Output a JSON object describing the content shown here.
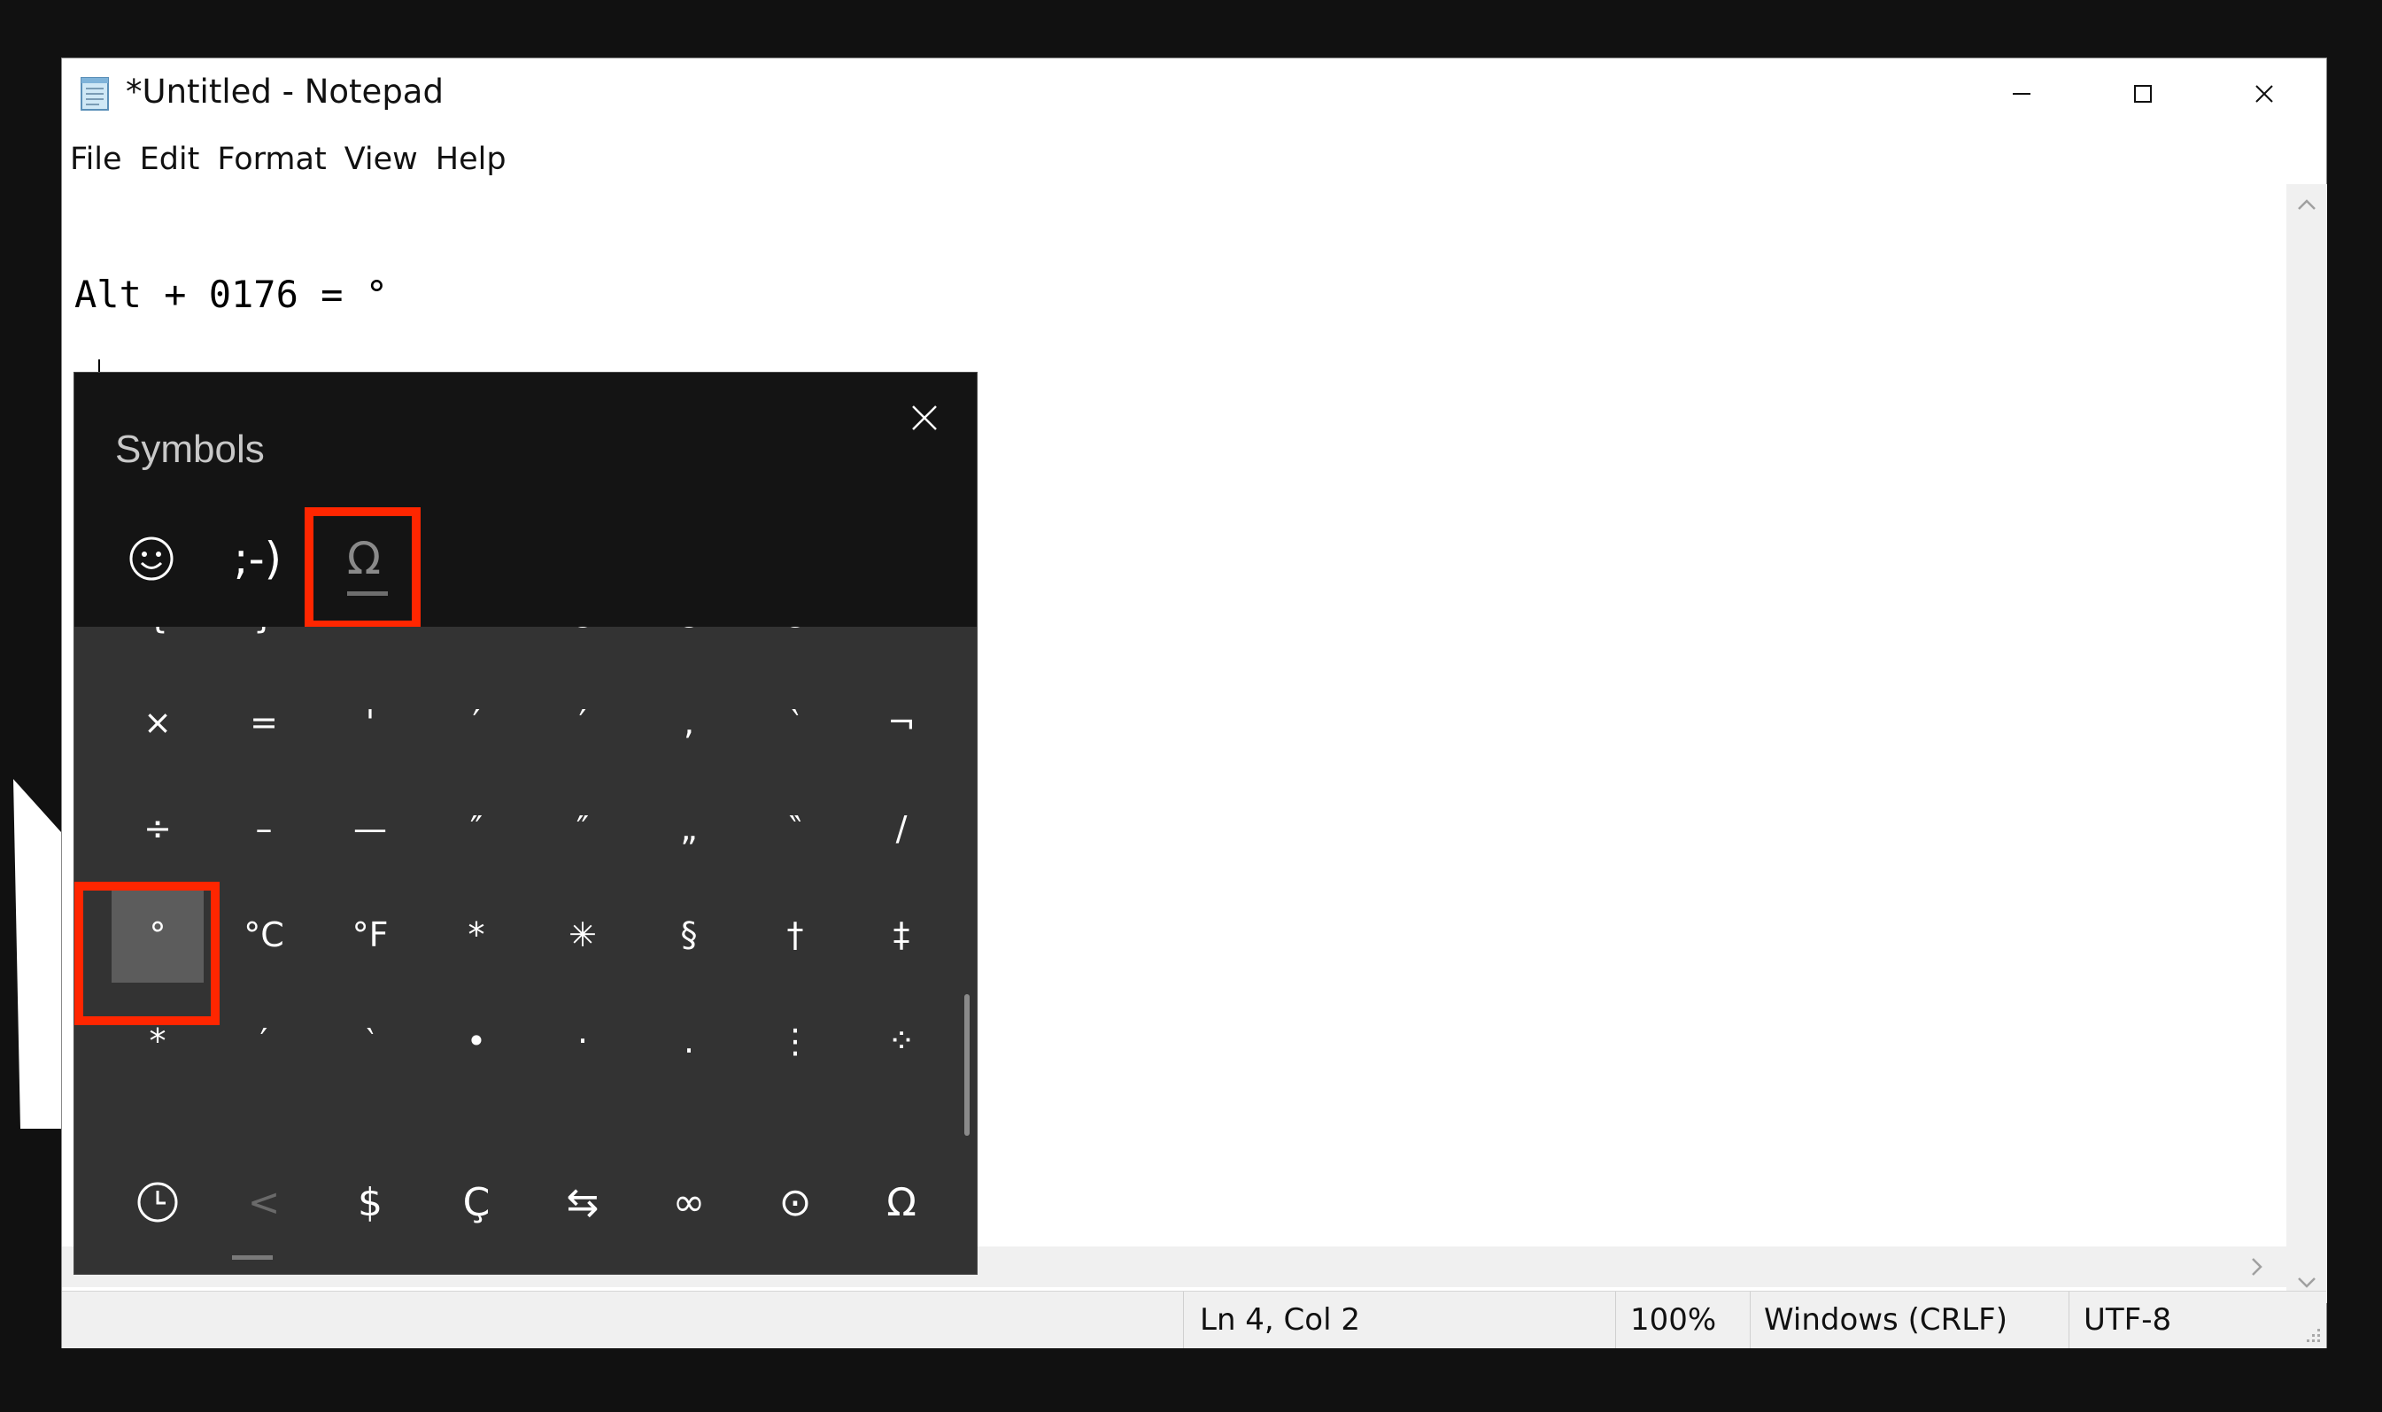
{
  "window": {
    "title": "*Untitled - Notepad",
    "controls": {
      "minimize": "–",
      "maximize": "☐",
      "close": "✕"
    }
  },
  "menu": [
    "File",
    "Edit",
    "Format",
    "View",
    "Help"
  ],
  "editor": {
    "lines": [
      "Alt + 0176 = °",
      "°"
    ]
  },
  "status": {
    "position": "Ln 4, Col 2",
    "zoom": "100%",
    "line_endings": "Windows (CRLF)",
    "encoding": "UTF-8"
  },
  "symbols_panel": {
    "title": "Symbols",
    "tabs": [
      {
        "name": "emoji",
        "icon": "smiley-icon"
      },
      {
        "name": "kaomoji",
        "label": ";-)"
      },
      {
        "name": "symbols",
        "label": "Ω",
        "selected": true
      }
    ],
    "grid_rows": [
      [
        "{",
        "}",
        "«",
        "»",
        "©",
        "®",
        "℗",
        "™"
      ],
      [
        "×",
        "=",
        "'",
        "′",
        "′",
        ",",
        "‵",
        "¬"
      ],
      [
        "÷",
        "–",
        "—",
        "″",
        "″",
        "„",
        "‶",
        "/"
      ],
      [
        "°",
        "°C",
        "°F",
        "*",
        "✳",
        "§",
        "†",
        "‡"
      ],
      [
        "*",
        "′",
        "‵",
        "•",
        "·",
        ".",
        "⋮",
        "⁘"
      ]
    ],
    "selected_symbol": "°",
    "categories": [
      {
        "name": "recent",
        "icon": "clock-icon"
      },
      {
        "name": "punctuation",
        "label": "<"
      },
      {
        "name": "currency",
        "label": "$"
      },
      {
        "name": "latin",
        "label": "Ç"
      },
      {
        "name": "arrows",
        "label": "⇆"
      },
      {
        "name": "math",
        "label": "∞"
      },
      {
        "name": "geometric",
        "label": "⊙"
      },
      {
        "name": "language",
        "label": "Ω"
      }
    ]
  },
  "colors": {
    "highlight": "#ff2600",
    "panel_bg": "#141414",
    "grid_bg": "#333333"
  }
}
